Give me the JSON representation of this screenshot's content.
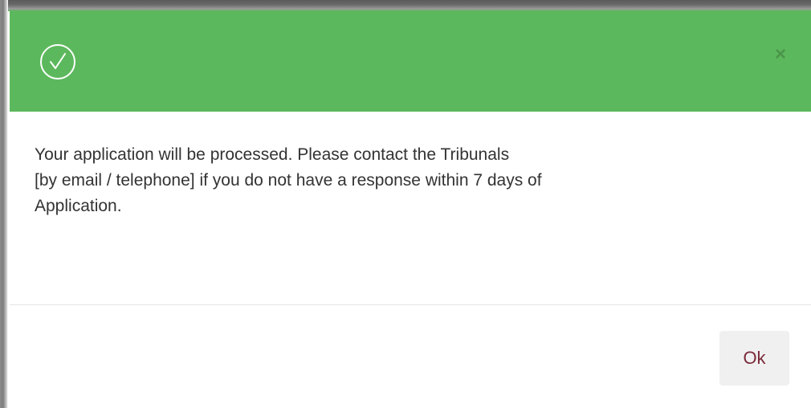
{
  "dialog": {
    "close_label": "×",
    "message_lines": [
      "Your application will be processed. Please contact the Tribunals",
      "[by email / telephone] if you do not have a response within 7 days of",
      "Application."
    ],
    "ok_label": "Ok"
  },
  "icons": {
    "header": "check-circle-icon",
    "close": "close-icon"
  },
  "colors": {
    "header_background": "#5cb85c",
    "ok_button_background": "#f0f0f0",
    "ok_button_text": "#7a2a3a",
    "body_text": "#333333"
  }
}
